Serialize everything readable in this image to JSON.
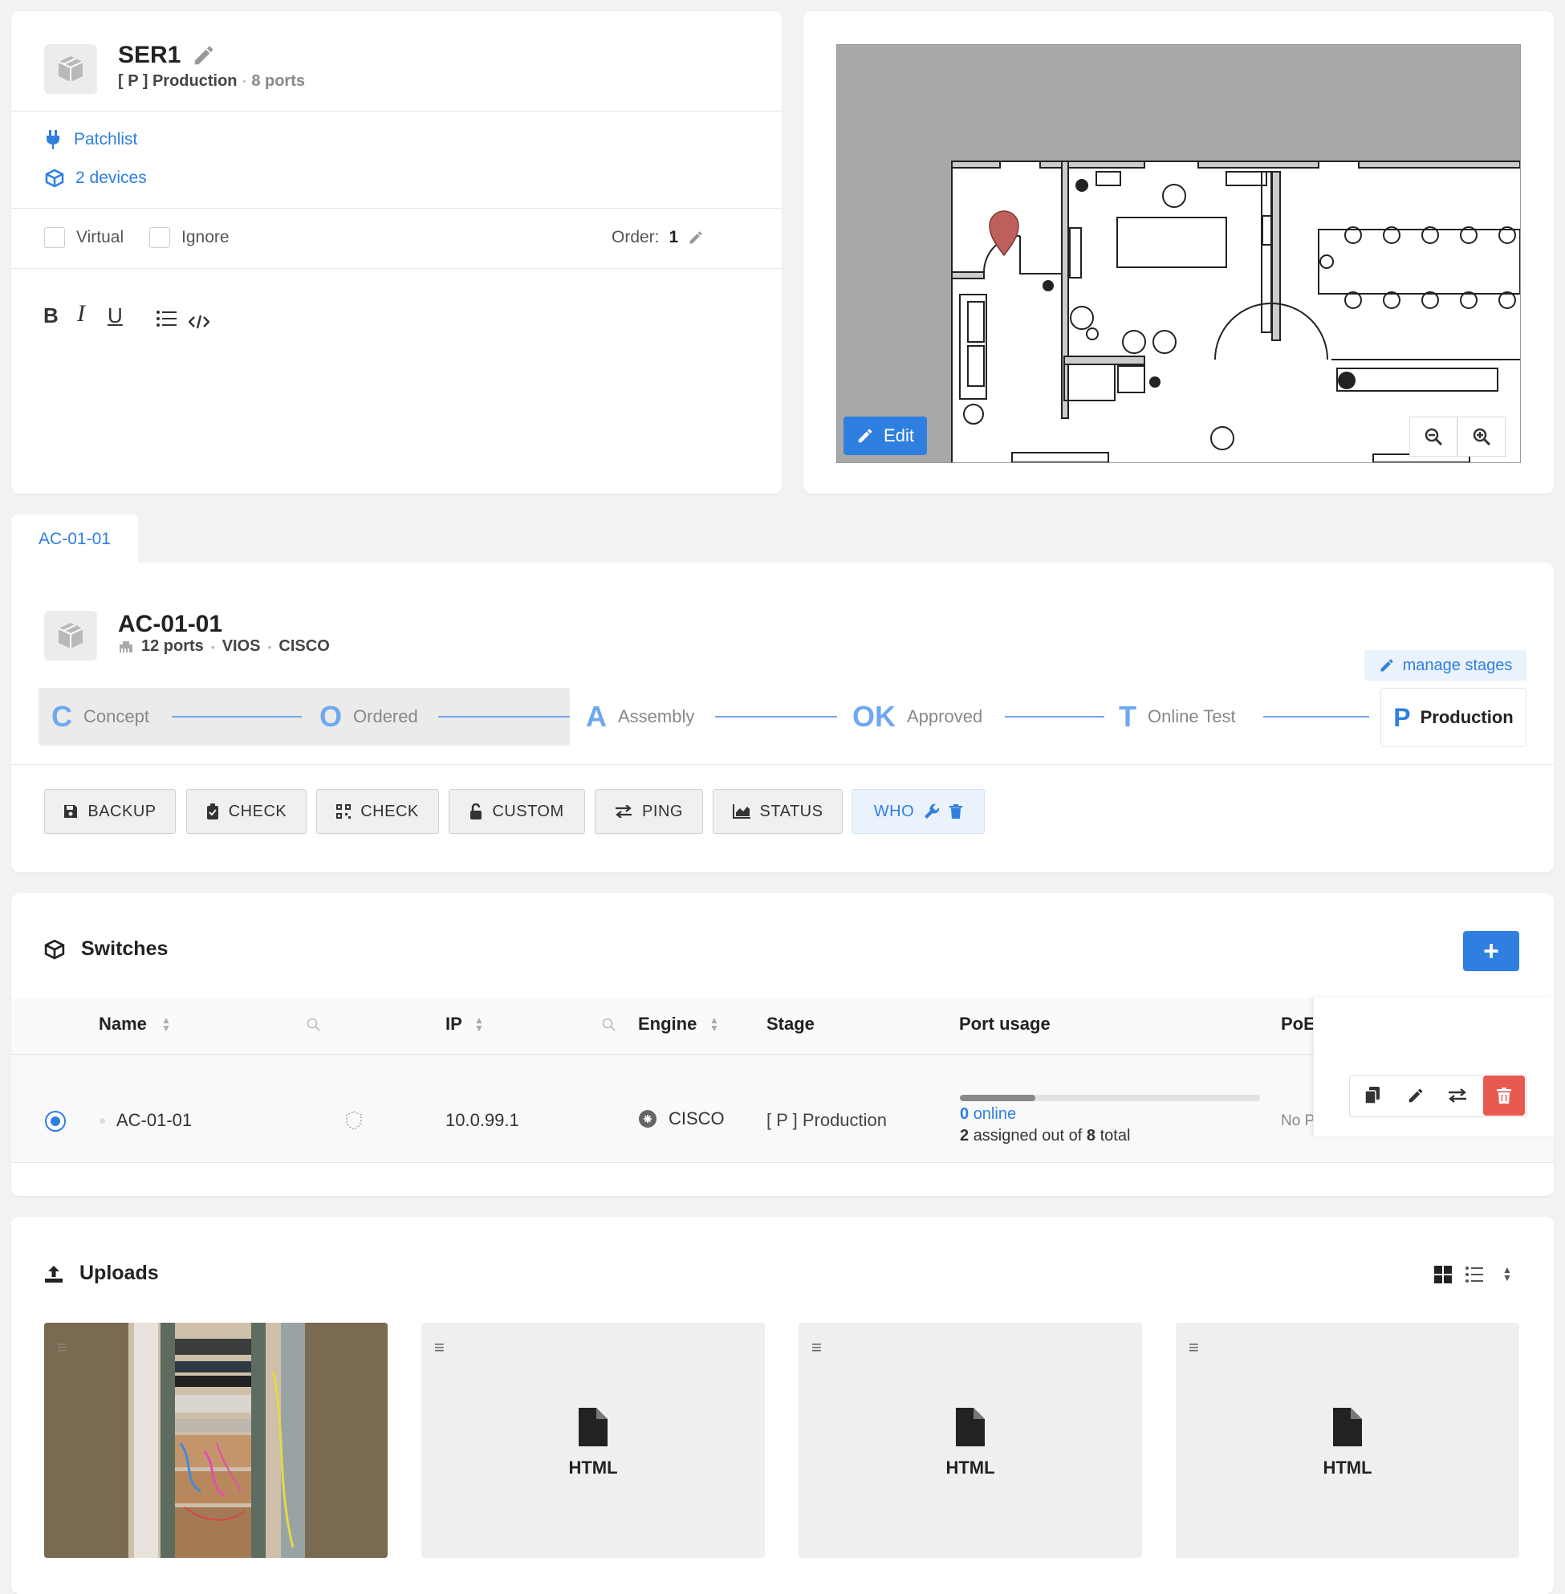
{
  "top_card": {
    "title": "SER1",
    "stage": "[ P ] Production",
    "sep": "·",
    "ports": "8 ports",
    "links": {
      "patchlist": "Patchlist",
      "devices": "2 devices"
    },
    "checks": {
      "virtual": "Virtual",
      "ignore": "Ignore"
    },
    "order_label": "Order:",
    "order_value": "1"
  },
  "floorplan": {
    "edit_label": "Edit"
  },
  "tab": {
    "label": "AC-01-01"
  },
  "device": {
    "title": "AC-01-01",
    "ports": "12 ports",
    "model": "VIOS",
    "vendor": "CISCO",
    "dot": "•",
    "manage_stages": "manage stages",
    "stages": [
      {
        "letter": "C",
        "name": "Concept"
      },
      {
        "letter": "O",
        "name": "Ordered"
      },
      {
        "letter": "A",
        "name": "Assembly"
      },
      {
        "letter": "OK",
        "name": "Approved"
      },
      {
        "letter": "T",
        "name": "Online Test"
      },
      {
        "letter": "P",
        "name": "Production"
      }
    ],
    "actions": [
      "BACKUP",
      "CHECK",
      "CHECK",
      "CUSTOM",
      "PING",
      "STATUS",
      "WHO"
    ]
  },
  "switches": {
    "title": "Switches",
    "add_label": "+",
    "columns": {
      "name": "Name",
      "ip": "IP",
      "engine": "Engine",
      "stage": "Stage",
      "port_usage": "Port usage",
      "poe": "PoE"
    },
    "rows": [
      {
        "name": "AC-01-01",
        "ip": "10.0.99.1",
        "engine": "CISCO",
        "stage": "[ P ] Production",
        "online_count": "0",
        "online_label": "online",
        "assigned_prefix": "2",
        "assigned_mid": "assigned out of",
        "assigned_total": "8",
        "assigned_suffix": "total",
        "usage_fraction": 0.25,
        "poe": "No P"
      }
    ]
  },
  "uploads": {
    "title": "Uploads",
    "items": [
      {
        "type": "image"
      },
      {
        "type": "HTML"
      },
      {
        "type": "HTML"
      },
      {
        "type": "HTML"
      }
    ]
  },
  "colors": {
    "accent": "#2f7fe0",
    "danger": "#e85a4f",
    "marker": "#c0605c"
  }
}
